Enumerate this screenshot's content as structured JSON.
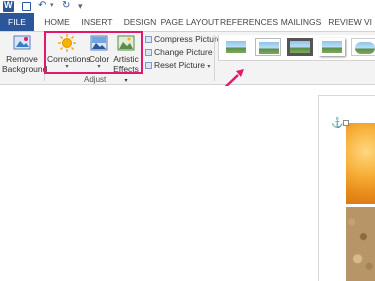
{
  "quick_access": {
    "app_icon": "word-app-icon",
    "save_icon": "save-icon",
    "undo_icon": "undo-icon",
    "redo_icon": "redo-icon",
    "customize_icon": "chevron-down-icon"
  },
  "tabs": [
    {
      "label": "FILE"
    },
    {
      "label": "HOME"
    },
    {
      "label": "INSERT"
    },
    {
      "label": "DESIGN"
    },
    {
      "label": "PAGE LAYOUT"
    },
    {
      "label": "REFERENCES"
    },
    {
      "label": "MAILINGS"
    },
    {
      "label": "REVIEW"
    },
    {
      "label": "VI"
    }
  ],
  "ribbon": {
    "remove_background": {
      "line1": "Remove",
      "line2": "Background"
    },
    "corrections": {
      "label": "Corrections"
    },
    "color": {
      "label": "Color"
    },
    "artistic_effects": {
      "line1": "Artistic",
      "line2": "Effects"
    },
    "compress_pictures": "Compress Pictures",
    "change_picture": "Change Picture",
    "reset_picture": "Reset Picture",
    "group_label": "Adjust",
    "highlight_color": "#e0196a"
  },
  "picture_styles": {
    "count": 5
  },
  "colors": {
    "accent": "#2b579a",
    "annotation": "#e0196a"
  }
}
